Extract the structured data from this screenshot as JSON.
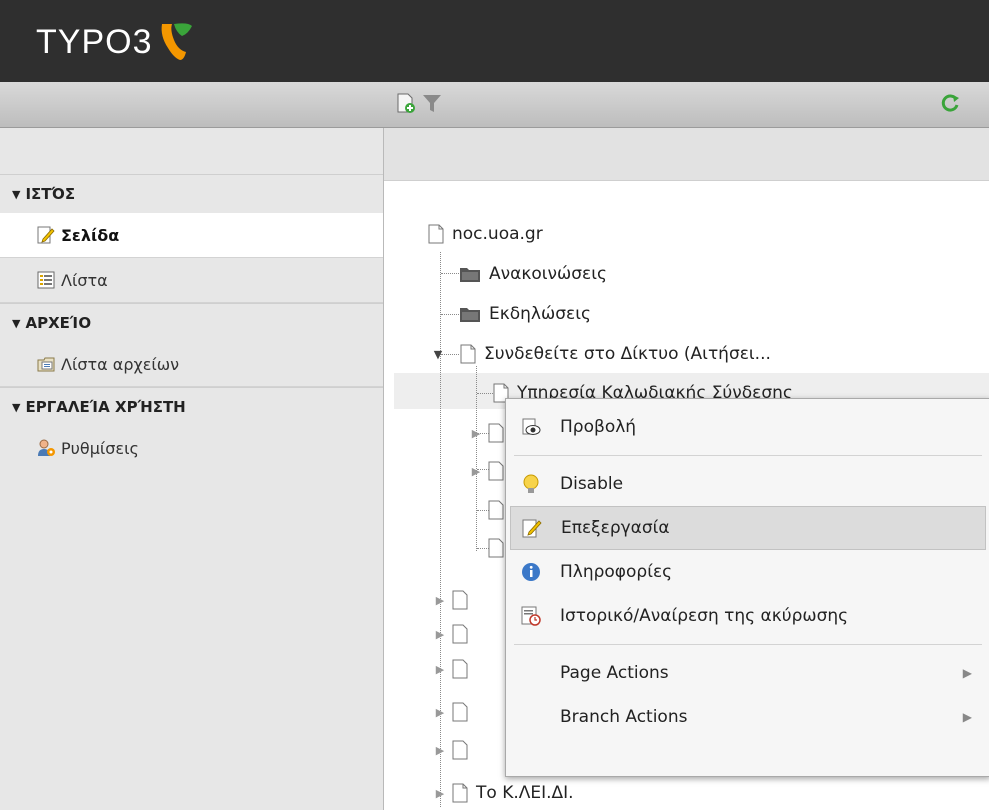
{
  "app": {
    "brand": "TYPO3"
  },
  "toolbar": {
    "new_page_icon": "new-page-icon",
    "filter_icon": "filter-icon",
    "refresh_icon": "refresh-icon"
  },
  "sidebar": {
    "sections": [
      {
        "title": "ΙΣΤΌΣ",
        "items": [
          {
            "label": "Σελίδα",
            "icon": "page-edit-icon",
            "active": true
          },
          {
            "label": "Λίστα",
            "icon": "list-icon",
            "active": false
          }
        ]
      },
      {
        "title": "ΑΡΧΕΊΟ",
        "items": [
          {
            "label": "Λίστα αρχείων",
            "icon": "file-list-icon",
            "active": false
          }
        ]
      },
      {
        "title": "ΕΡΓΑΛΕΊΑ ΧΡΉΣΤΗ",
        "items": [
          {
            "label": "Ρυθμίσεις",
            "icon": "user-settings-icon",
            "active": false
          }
        ]
      }
    ]
  },
  "tree": {
    "root": "noc.uoa.gr",
    "nodes": [
      {
        "label": "Ανακοινώσεις",
        "type": "folder"
      },
      {
        "label": "Εκδηλώσεις",
        "type": "folder"
      },
      {
        "label": "Συνδεθείτε στο Δίκτυο (Αιτήσει...",
        "type": "page",
        "expanded": true
      },
      {
        "label": "Υπηρεσία Καλωδιακής Σύνδεσης",
        "type": "page"
      },
      {
        "label": "Το Κ.ΛΕΙ.ΔΙ.",
        "type": "page"
      }
    ]
  },
  "context_menu": {
    "items": [
      {
        "label": "Προβολή",
        "icon": "view-icon"
      },
      {
        "label": "Disable",
        "icon": "lightbulb-icon"
      },
      {
        "label": "Επεξεργασία",
        "icon": "edit-icon",
        "highlighted": true
      },
      {
        "label": "Πληροφορίες",
        "icon": "info-icon"
      },
      {
        "label": "Ιστορικό/Αναίρεση της ακύρωσης",
        "icon": "history-icon"
      },
      {
        "label": "Page Actions",
        "submenu": true
      },
      {
        "label": "Branch Actions",
        "submenu": true
      }
    ]
  },
  "colors": {
    "topbar": "#2f2f2f",
    "accent_orange": "#f49700",
    "accent_green": "#3aa43a"
  }
}
